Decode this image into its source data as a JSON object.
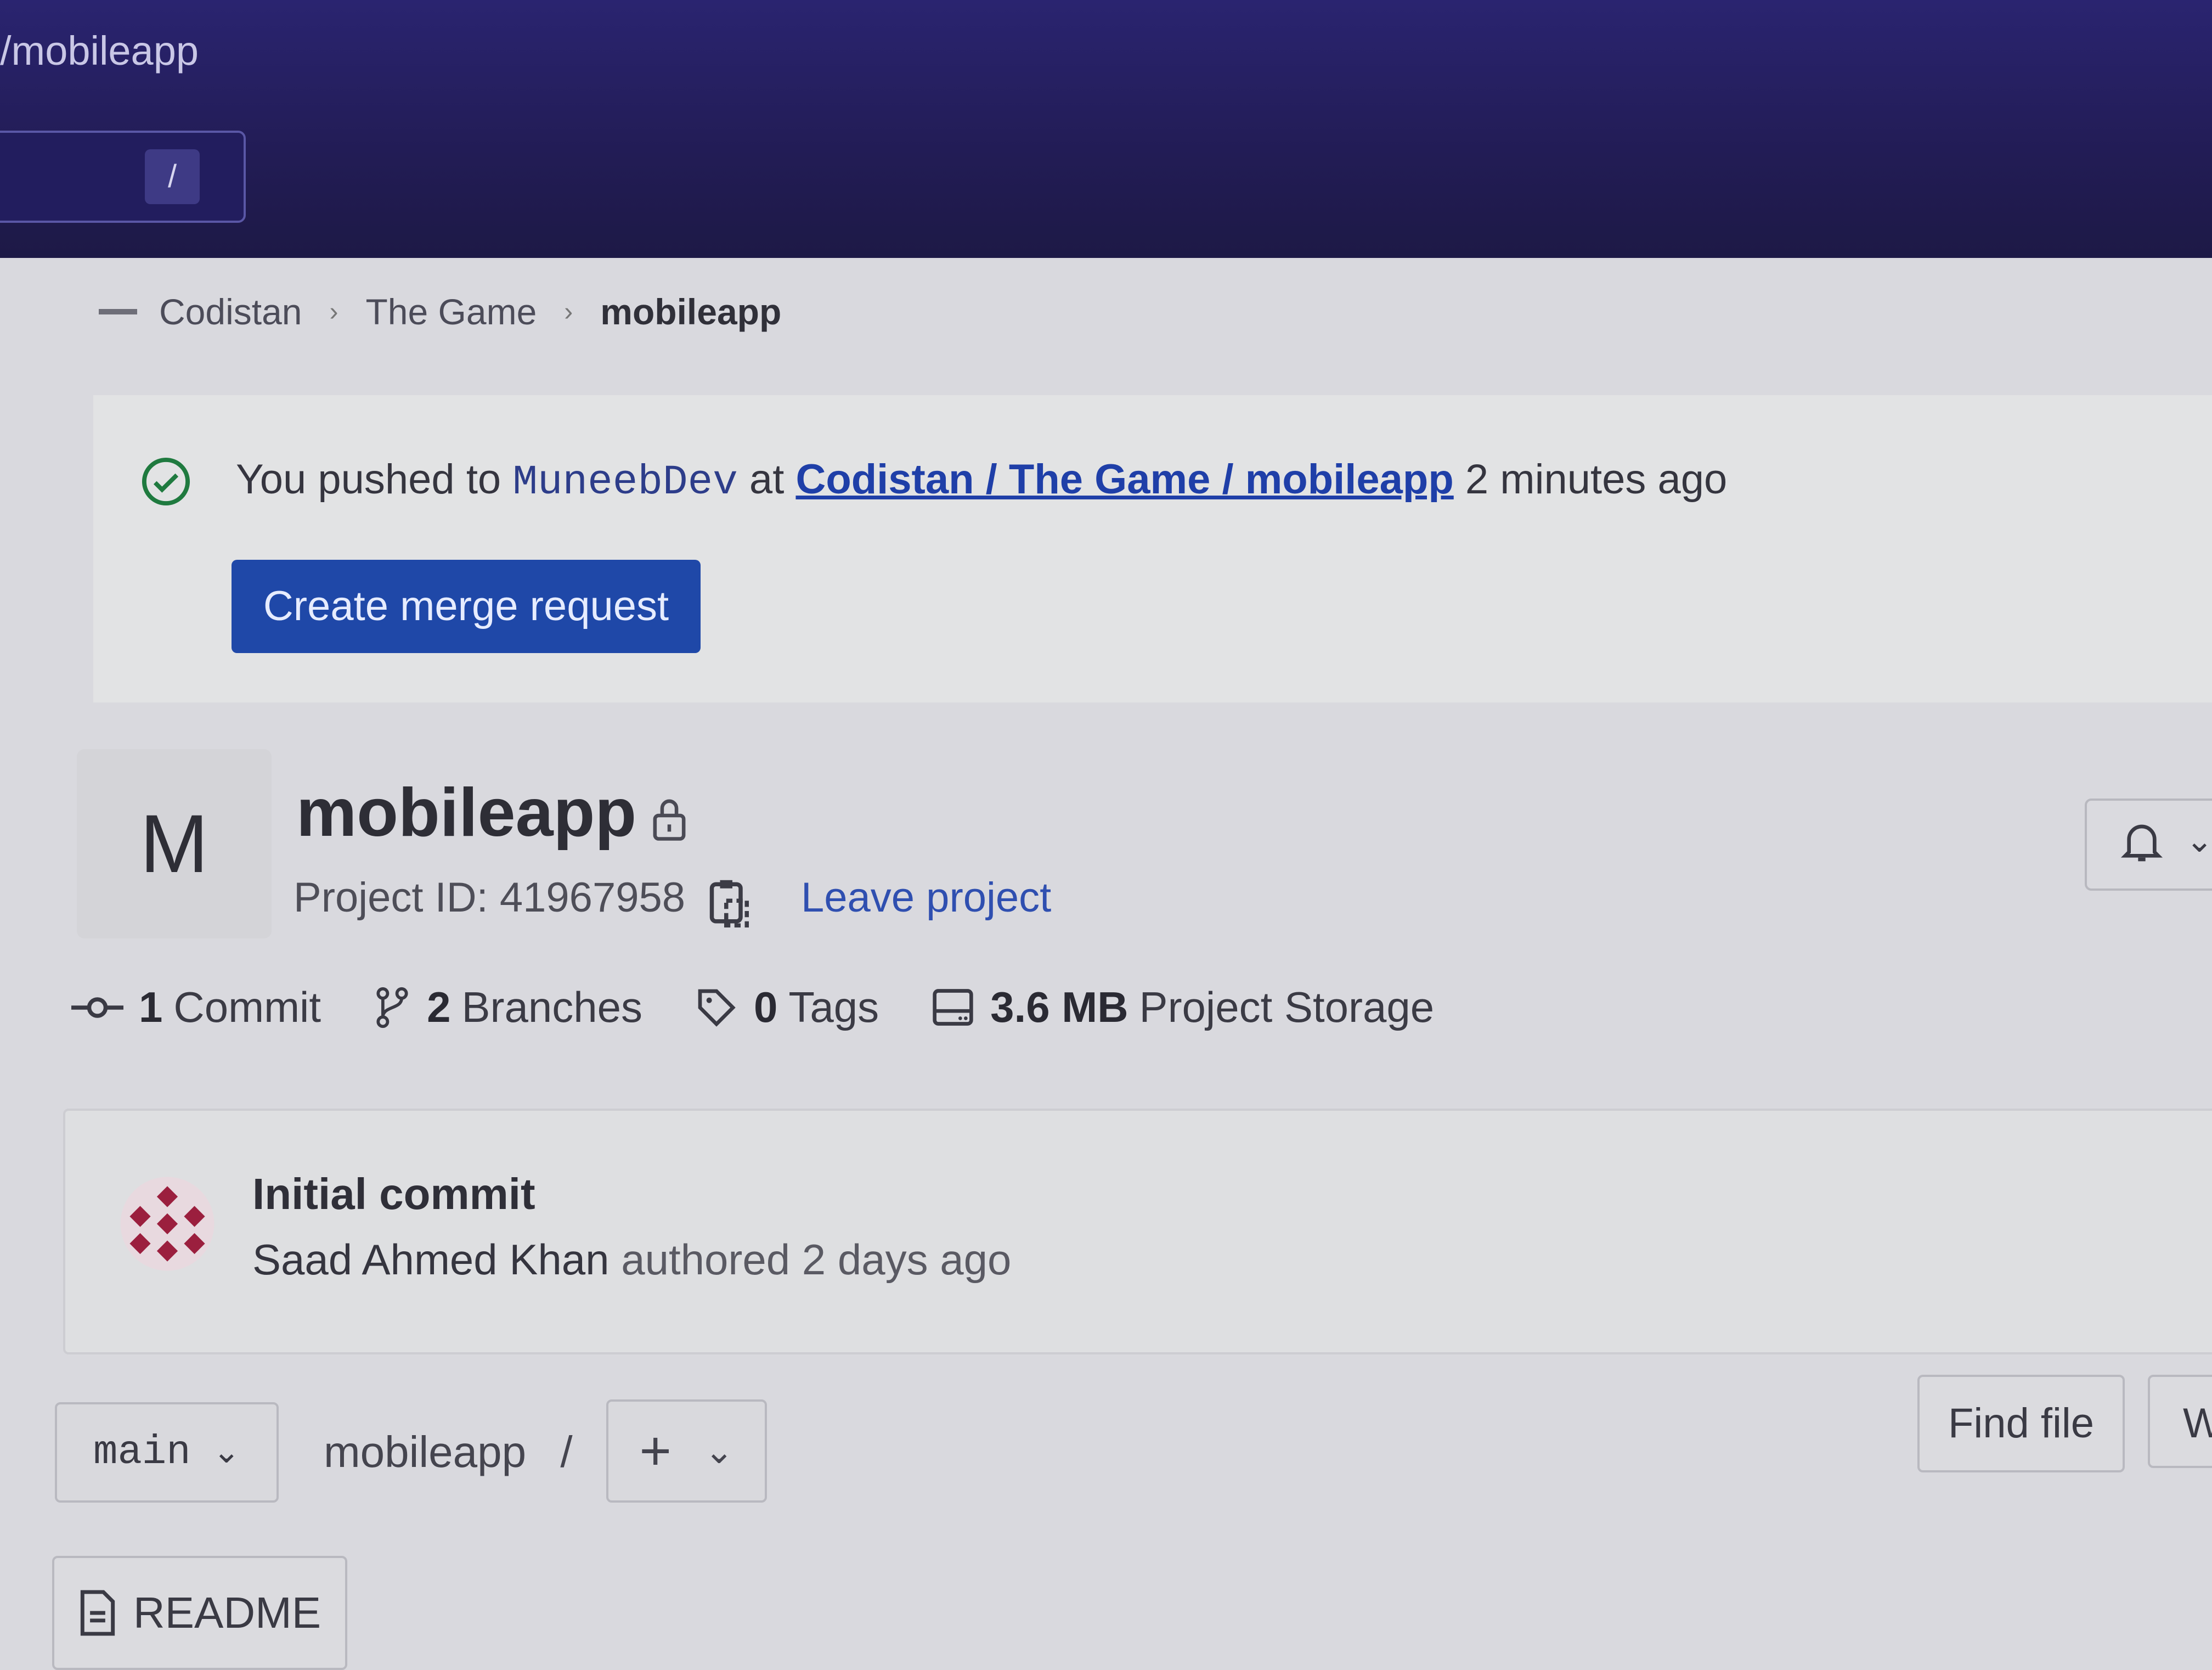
{
  "window": {
    "title": "/mobileapp"
  },
  "search": {
    "shortcut": "/"
  },
  "breadcrumb": {
    "items": [
      "Codistan",
      "The Game",
      "mobileapp"
    ]
  },
  "alert": {
    "prefix": "You pushed to",
    "branch": "MuneebDev",
    "at": "at",
    "path": "Codistan / The Game / mobileapp",
    "time": "2 minutes ago",
    "button_label": "Create merge request"
  },
  "project": {
    "avatar_letter": "M",
    "name": "mobileapp",
    "id_label": "Project ID: 41967958",
    "leave_label": "Leave project"
  },
  "stats": {
    "commits_count": "1",
    "commits_label": "Commit",
    "branches_count": "2",
    "branches_label": "Branches",
    "tags_count": "0",
    "tags_label": "Tags",
    "storage_size": "3.6 MB",
    "storage_label": "Project Storage"
  },
  "last_commit": {
    "title": "Initial commit",
    "author": "Saad Ahmed Khan",
    "action": "authored",
    "time": "2 days ago"
  },
  "repo": {
    "branch": "main",
    "path": "mobileapp",
    "path_sep": "/",
    "add_symbol": "+",
    "find_file_label": "Find file",
    "web_ide_label": "W",
    "readme_label": "README"
  }
}
